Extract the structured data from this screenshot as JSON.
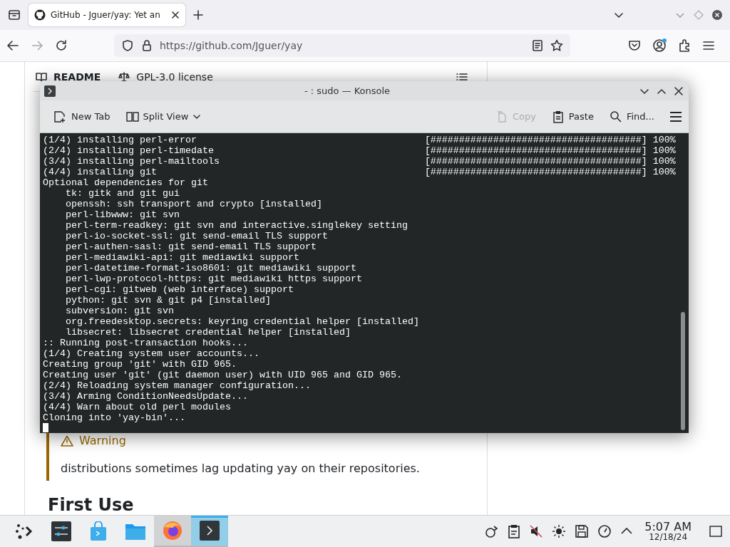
{
  "browser": {
    "tabs": [
      {
        "title": "GitHub - Jguer/yay: Yet an",
        "selected": true
      }
    ],
    "url": "https://github.com/Jguer/yay"
  },
  "page": {
    "readme_tab": "README",
    "license": "GPL-3.0 license",
    "warning_title": "Warning",
    "warning_text": "distributions sometimes lag updating yay on their repositories.",
    "heading": "First Use"
  },
  "konsole": {
    "title": "- : sudo — Konsole",
    "toolbar": [
      {
        "kind": "new-tab",
        "label": "New Tab",
        "disabled": false
      },
      {
        "kind": "split-view",
        "label": "Split View",
        "disabled": false
      },
      {
        "kind": "copy",
        "label": "Copy",
        "disabled": true
      },
      {
        "kind": "paste",
        "label": "Paste",
        "disabled": false
      },
      {
        "kind": "find",
        "label": "Find...",
        "disabled": false
      }
    ],
    "lines": [
      {
        "text": "(1/4) installing perl-error",
        "progress": "[#####################################] 100%"
      },
      {
        "text": "(2/4) installing perl-timedate",
        "progress": "[#####################################] 100%"
      },
      {
        "text": "(3/4) installing perl-mailtools",
        "progress": "[#####################################] 100%"
      },
      {
        "text": "(4/4) installing git",
        "progress": "[#####################################] 100%"
      },
      {
        "text": "Optional dependencies for git"
      },
      {
        "text": "    tk: gitk and git gui"
      },
      {
        "text": "    openssh: ssh transport and crypto [installed]"
      },
      {
        "text": "    perl-libwww: git svn"
      },
      {
        "text": "    perl-term-readkey: git svn and interactive.singlekey setting"
      },
      {
        "text": "    perl-io-socket-ssl: git send-email TLS support"
      },
      {
        "text": "    perl-authen-sasl: git send-email TLS support"
      },
      {
        "text": "    perl-mediawiki-api: git mediawiki support"
      },
      {
        "text": "    perl-datetime-format-iso8601: git mediawiki support"
      },
      {
        "text": "    perl-lwp-protocol-https: git mediawiki https support"
      },
      {
        "text": "    perl-cgi: gitweb (web interface) support"
      },
      {
        "text": "    python: git svn & git p4 [installed]"
      },
      {
        "text": "    subversion: git svn"
      },
      {
        "text": "    org.freedesktop.secrets: keyring credential helper [installed]"
      },
      {
        "text": "    libsecret: libsecret credential helper [installed]"
      },
      {
        "text": ":: Running post-transaction hooks..."
      },
      {
        "text": "(1/4) Creating system user accounts..."
      },
      {
        "text": "Creating group 'git' with GID 965."
      },
      {
        "text": "Creating user 'git' (git daemon user) with UID 965 and GID 965."
      },
      {
        "text": "(2/4) Reloading system manager configuration..."
      },
      {
        "text": "(3/4) Arming ConditionNeedsUpdate..."
      },
      {
        "text": "(4/4) Warn about old perl modules"
      },
      {
        "text": "Cloning into 'yay-bin'..."
      }
    ],
    "cursor": true
  },
  "taskbar": {
    "apps": [
      {
        "kind": "settings",
        "running": false,
        "active": false
      },
      {
        "kind": "store",
        "running": false,
        "active": false
      },
      {
        "kind": "files",
        "running": false,
        "active": false
      },
      {
        "kind": "firefox",
        "running": true,
        "active": false
      },
      {
        "kind": "terminal",
        "running": true,
        "active": true
      }
    ],
    "time": "5:07 AM",
    "date": "12/18/24"
  }
}
